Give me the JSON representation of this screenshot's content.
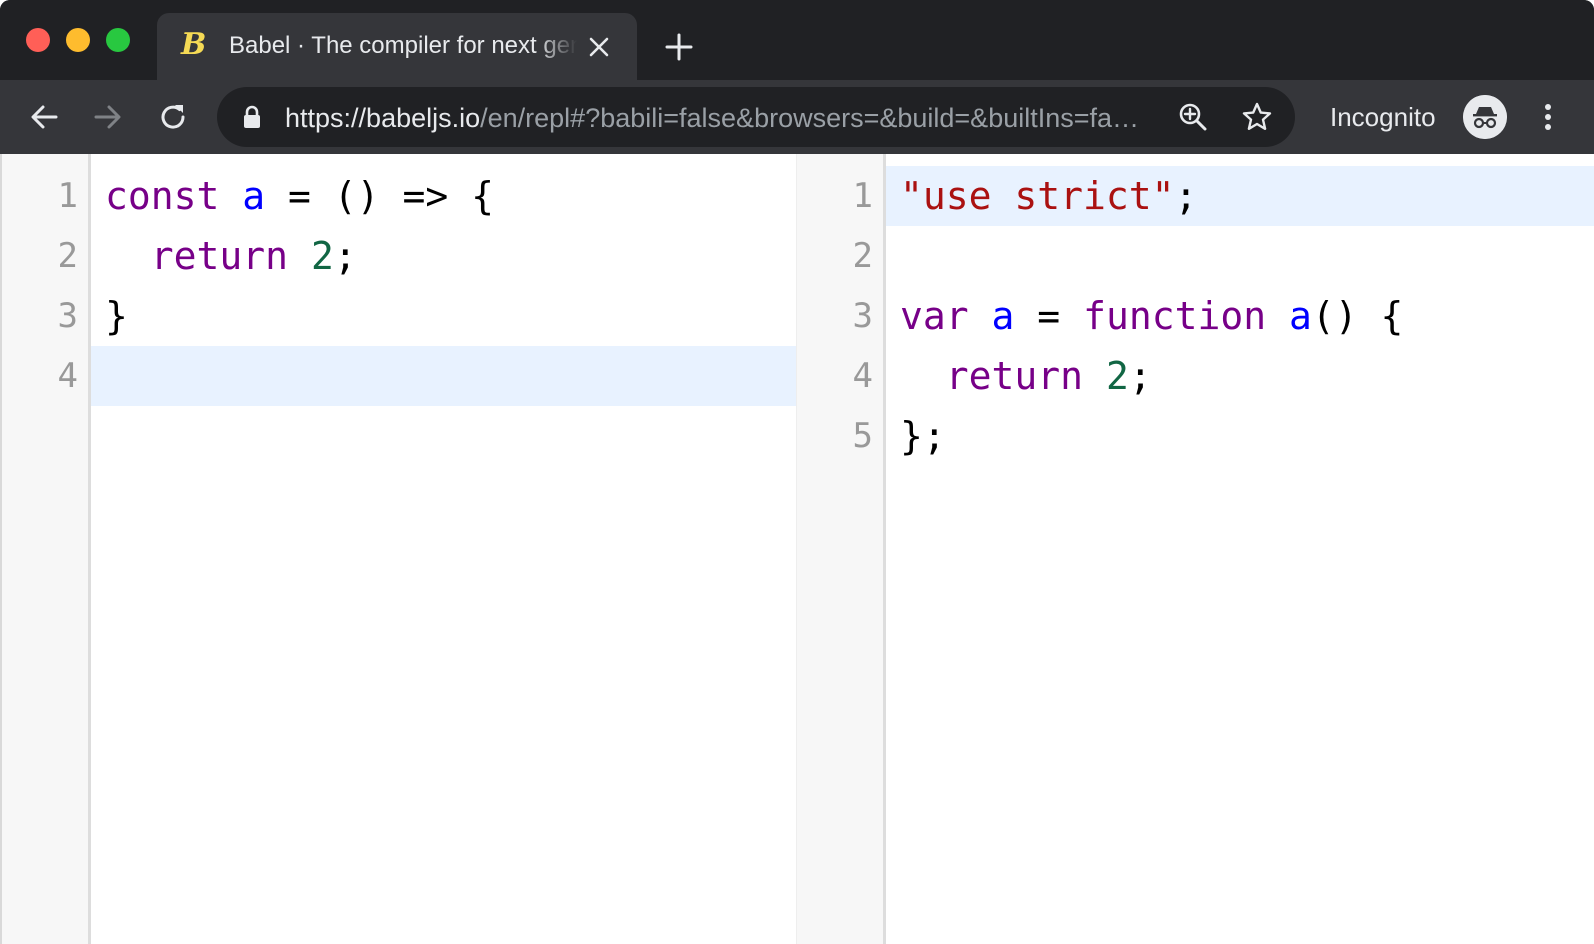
{
  "browser": {
    "tab": {
      "title": "Babel · The compiler for next generation JavaScript",
      "favicon_glyph": "B"
    },
    "url": {
      "scheme": "https://",
      "host": "babeljs.io",
      "path": "/en/repl#?babili=false&browsers=&build=&builtIns=false"
    },
    "incognito_label": "Incognito",
    "colors": {
      "frame": "#202124",
      "toolbar": "#35363a",
      "tab_active": "#35363a",
      "favicon": "#f5da55"
    },
    "icons": [
      "back-arrow-icon",
      "forward-arrow-icon",
      "reload-icon",
      "lock-icon",
      "zoom-icon",
      "star-icon",
      "incognito-icon",
      "kebab-menu-icon",
      "close-icon",
      "plus-icon"
    ]
  },
  "editor_input": {
    "lines": [
      {
        "n": "1",
        "tokens": [
          [
            "kw",
            "const"
          ],
          [
            "pun",
            " "
          ],
          [
            "var",
            "a"
          ],
          [
            "pun",
            " = () => {"
          ]
        ]
      },
      {
        "n": "2",
        "tokens": [
          [
            "pun",
            "  "
          ],
          [
            "kw",
            "return"
          ],
          [
            "pun",
            " "
          ],
          [
            "num",
            "2"
          ],
          [
            "pun",
            ";"
          ]
        ]
      },
      {
        "n": "3",
        "tokens": [
          [
            "pun",
            "}"
          ]
        ]
      },
      {
        "n": "4",
        "tokens": [],
        "active": true
      }
    ]
  },
  "editor_output": {
    "lines": [
      {
        "n": "1",
        "tokens": [
          [
            "str",
            "\"use strict\""
          ],
          [
            "pun",
            ";"
          ]
        ],
        "active": true
      },
      {
        "n": "2",
        "tokens": []
      },
      {
        "n": "3",
        "tokens": [
          [
            "kw",
            "var"
          ],
          [
            "pun",
            " "
          ],
          [
            "var",
            "a"
          ],
          [
            "pun",
            " = "
          ],
          [
            "kw",
            "function"
          ],
          [
            "pun",
            " "
          ],
          [
            "var",
            "a"
          ],
          [
            "pun",
            "() {"
          ]
        ]
      },
      {
        "n": "4",
        "tokens": [
          [
            "pun",
            "  "
          ],
          [
            "kw",
            "return"
          ],
          [
            "pun",
            " "
          ],
          [
            "num",
            "2"
          ],
          [
            "pun",
            ";"
          ]
        ]
      },
      {
        "n": "5",
        "tokens": [
          [
            "pun",
            "};"
          ]
        ]
      }
    ]
  },
  "syntax_colors": {
    "keyword": "#770088",
    "variable": "#0000ff",
    "number": "#116644",
    "string": "#aa1111",
    "active_line": "#e8f2ff"
  }
}
